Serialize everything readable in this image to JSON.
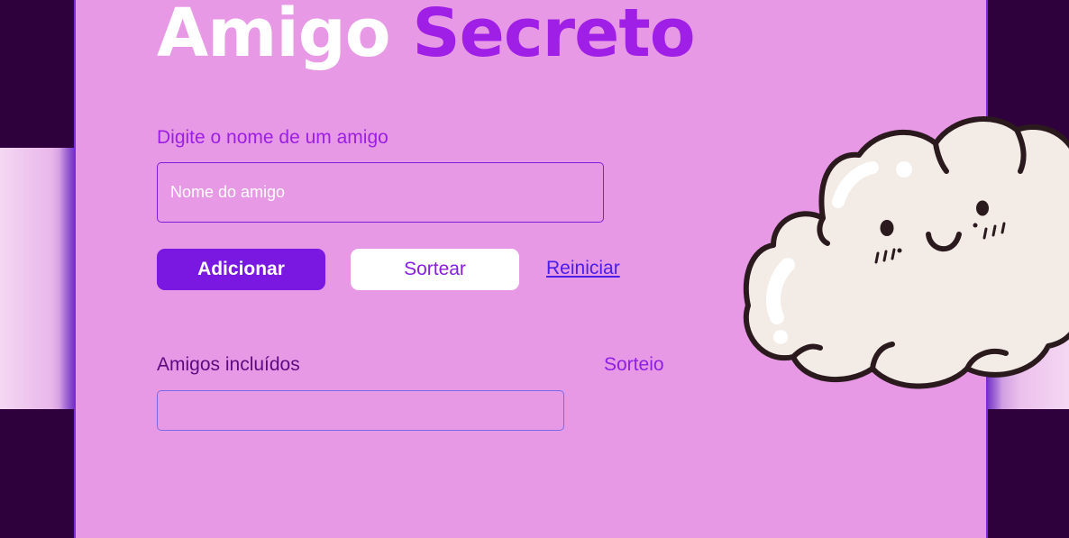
{
  "title": {
    "word1": "Amigo",
    "word2": "Secreto"
  },
  "form": {
    "name_label": "Digite o nome de um amigo",
    "name_placeholder": "Nome do amigo",
    "name_value": ""
  },
  "actions": {
    "add_label": "Adicionar",
    "draw_label": "Sortear",
    "reset_label": "Reiniciar"
  },
  "lists": {
    "friends_label": "Amigos incluídos",
    "friends": [],
    "draw_label": "Sorteio",
    "result": ""
  },
  "illustration": {
    "icon": "smiling-cloud-icon"
  },
  "colors": {
    "panel": "#e899e5",
    "accent": "#a01fe6",
    "button_primary": "#7a18e2",
    "background": "#2e003c"
  }
}
